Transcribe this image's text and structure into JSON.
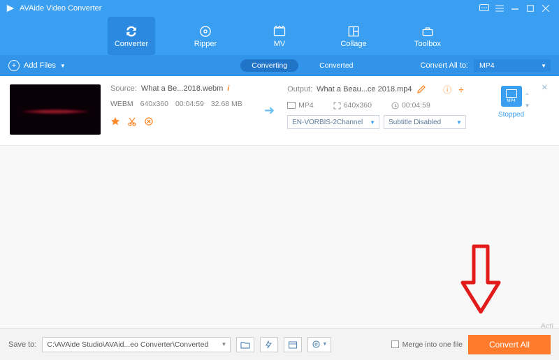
{
  "app": {
    "title": "AVAide Video Converter"
  },
  "tabs": {
    "converter": "Converter",
    "ripper": "Ripper",
    "mv": "MV",
    "collage": "Collage",
    "toolbox": "Toolbox"
  },
  "subbar": {
    "add_files": "Add Files",
    "converting": "Converting",
    "converted": "Converted",
    "convert_all_to_label": "Convert All to:",
    "convert_all_to_value": "MP4"
  },
  "file": {
    "source_label": "Source:",
    "source_name": "What a Be...2018.webm",
    "source_format": "WEBM",
    "source_res": "640x360",
    "source_dur": "00:04:59",
    "source_size": "32.68 MB",
    "output_label": "Output:",
    "output_name": "What a Beau...ce 2018.mp4",
    "out_format": "MP4",
    "out_res": "640x360",
    "out_dur": "00:04:59",
    "audio_value": "EN-VORBIS-2Channel",
    "subtitle_value": "Subtitle Disabled",
    "tile_fmt": "MP4",
    "status": "Stopped"
  },
  "bottom": {
    "save_to_label": "Save to:",
    "save_to_path": "C:\\AVAide Studio\\AVAid...eo Converter\\Converted",
    "merge_label": "Merge into one file",
    "convert_all": "Convert All"
  },
  "watermark": "Acti"
}
